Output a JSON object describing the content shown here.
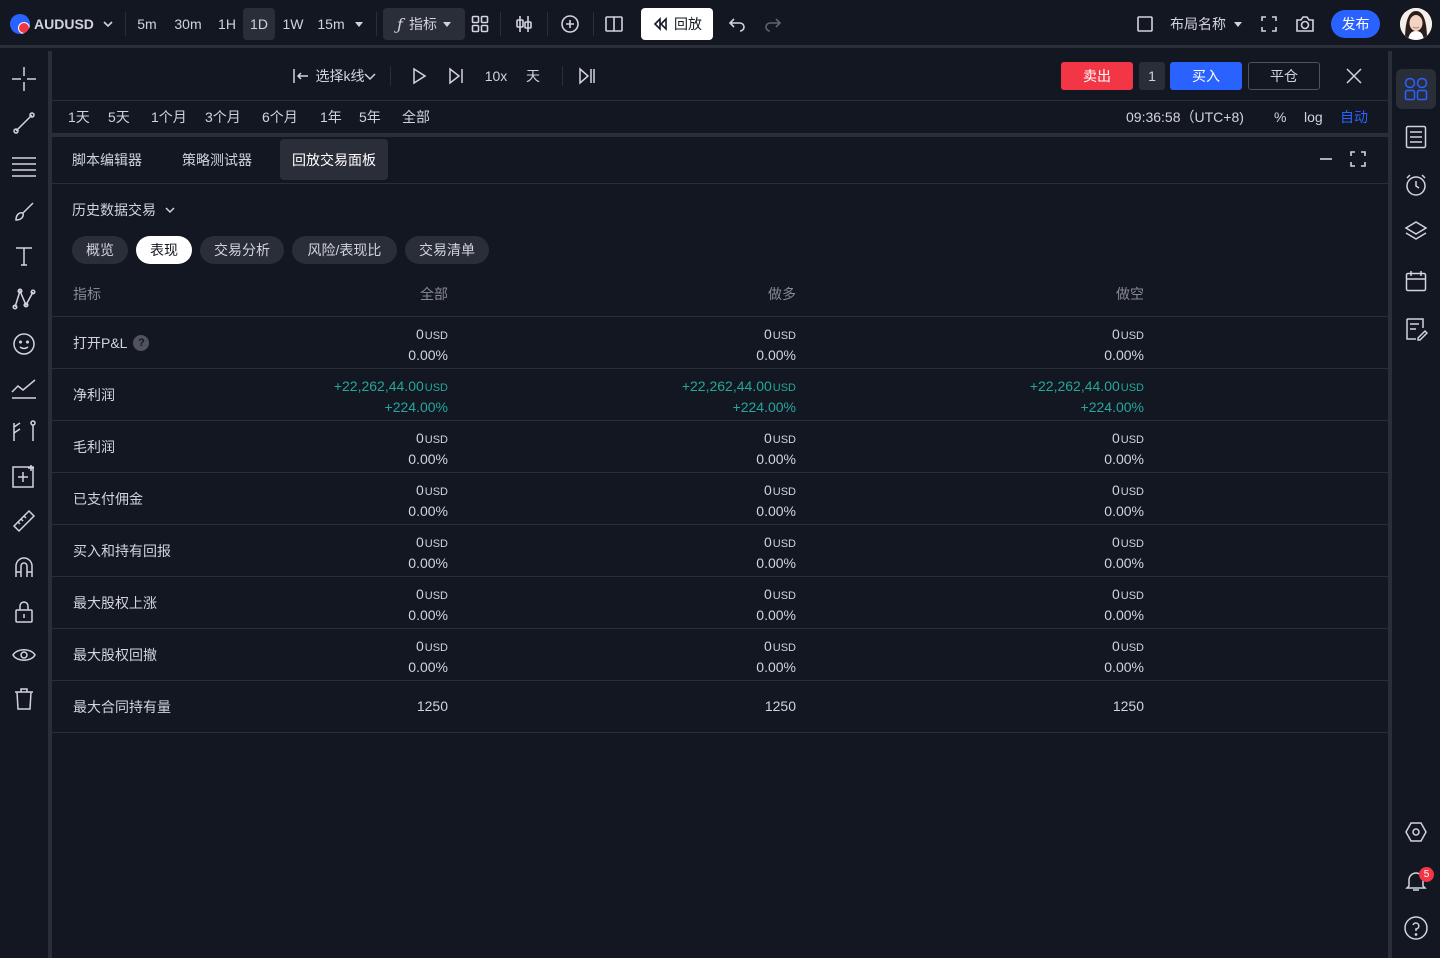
{
  "topbar": {
    "symbol": "AUDUSD",
    "timeframes": [
      "5m",
      "30m",
      "1H",
      "1D",
      "1W",
      "15m"
    ],
    "active_timeframe": "1D",
    "indicators_label": "指标",
    "replay_label": "回放",
    "layout_name_label": "布局名称",
    "publish_label": "发布"
  },
  "replay_bar": {
    "select_bar_label": "选择k线",
    "speed_label": "10x",
    "interval_label": "天",
    "sell_label": "卖出",
    "quantity": "1",
    "buy_label": "买入",
    "close_position_label": "平仓"
  },
  "range_bar": {
    "ranges": [
      "1天",
      "5天",
      "1个月",
      "3个月",
      "6个月",
      "1年",
      "5年",
      "全部"
    ],
    "clock": "09:36:58（UTC+8)",
    "percent_label": "%",
    "log_label": "log",
    "auto_label": "自动"
  },
  "panel": {
    "tabs": [
      "脚本编辑器",
      "策略测试器",
      "回放交易面板"
    ],
    "active_tab": "回放交易面板",
    "history_dropdown_label": "历史数据交易",
    "sub_tabs": [
      "概览",
      "表现",
      "交易分析",
      "风险/表现比",
      "交易清单"
    ],
    "active_sub_tab": "表现",
    "table": {
      "headers": [
        "指标",
        "全部",
        "做多",
        "做空"
      ],
      "rows": [
        {
          "label": "打开P&L",
          "help": "?",
          "all": [
            "0",
            "USD",
            "0.00%"
          ],
          "long": [
            "0",
            "USD",
            "0.00%"
          ],
          "short": [
            "0",
            "USD",
            "0.00%"
          ]
        },
        {
          "label": "净利润",
          "all": [
            "+22,262,44.00",
            "USD",
            "+224.00%"
          ],
          "long": [
            "+22,262,44.00",
            "USD",
            "+224.00%"
          ],
          "short": [
            "+22,262,44.00",
            "USD",
            "+224.00%"
          ]
        },
        {
          "label": "毛利润",
          "all": [
            "0",
            "USD",
            "0.00%"
          ],
          "long": [
            "0",
            "USD",
            "0.00%"
          ],
          "short": [
            "0",
            "USD",
            "0.00%"
          ]
        },
        {
          "label": "已支付佣金",
          "all": [
            "0",
            "USD",
            "0.00%"
          ],
          "long": [
            "0",
            "USD",
            "0.00%"
          ],
          "short": [
            "0",
            "USD",
            "0.00%"
          ]
        },
        {
          "label": "买入和持有回报",
          "all": [
            "0",
            "USD",
            "0.00%"
          ],
          "long": [
            "0",
            "USD",
            "0.00%"
          ],
          "short": [
            "0",
            "USD",
            "0.00%"
          ]
        },
        {
          "label": "最大股权上涨",
          "all": [
            "0",
            "USD",
            "0.00%"
          ],
          "long": [
            "0",
            "USD",
            "0.00%"
          ],
          "short": [
            "0",
            "USD",
            "0.00%"
          ]
        },
        {
          "label": "最大股权回撤",
          "all": [
            "0",
            "USD",
            "0.00%"
          ],
          "long": [
            "0",
            "USD",
            "0.00%"
          ],
          "short": [
            "0",
            "USD",
            "0.00%"
          ]
        },
        {
          "label": "最大合同持有量",
          "all": [
            "1250"
          ],
          "long": [
            "1250"
          ],
          "short": [
            "1250"
          ]
        }
      ]
    }
  },
  "notifications": {
    "count": "5"
  },
  "colors": {
    "background": "#131722",
    "border": "#2a2e39",
    "accent_blue": "#2962ff",
    "sell_red": "#f23645",
    "positive_green": "#26a69a"
  },
  "icons": {
    "left_toolbar": [
      "crosshair-icon",
      "trend-line-icon",
      "fib-levels-icon",
      "brush-icon",
      "text-icon",
      "pattern-icon",
      "emoji-icon",
      "forecast-icon",
      "measure-tools-icon",
      "zoom-icon",
      "ruler-icon",
      "magnet-icon",
      "lock-icon",
      "eye-icon",
      "trash-icon"
    ],
    "right_toolbar": [
      "widgets-icon",
      "watchlist-icon",
      "alarm-icon",
      "layers-icon",
      "calendar-icon",
      "notes-icon",
      "hexagon-icon",
      "bell-icon",
      "help-icon"
    ]
  }
}
